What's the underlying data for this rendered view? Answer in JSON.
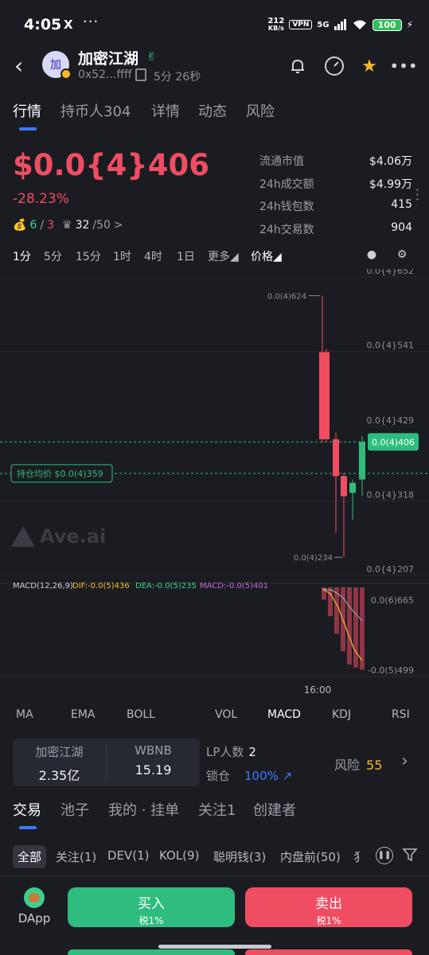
{
  "status_bar": {
    "time": "4:05",
    "app_icon": "X",
    "more": "···",
    "net_speed_top": "212",
    "net_speed_unit": "KB/s",
    "vpn": "VPN",
    "signal": "5G",
    "battery": "100"
  },
  "header": {
    "avatar_text": "加",
    "name": "加密江湖",
    "badge_icon": "✌",
    "address": "0x52...ffff",
    "age": "5分 26秒"
  },
  "main_tabs": [
    {
      "label": "行情",
      "active": true
    },
    {
      "label": "持币人304",
      "active": false
    },
    {
      "label": "详情",
      "active": false
    },
    {
      "label": "动态",
      "active": false
    },
    {
      "label": "风险",
      "active": false
    }
  ],
  "price": {
    "value": "$0.0{4}406",
    "change": "-28.23%",
    "chip1_a": "6",
    "chip1_sep": "/",
    "chip1_b": "3",
    "chip2_a": "32",
    "chip2_b": "/50",
    "chip2_chev": ">"
  },
  "stats": [
    {
      "k": "流通市值",
      "v": "$4.06万"
    },
    {
      "k": "24h成交额",
      "v": "$4.99万"
    },
    {
      "k": "24h钱包数",
      "v": "415"
    },
    {
      "k": "24h交易数",
      "v": "904"
    }
  ],
  "timeframes": [
    {
      "label": "1分",
      "active": true
    },
    {
      "label": "5分",
      "active": false
    },
    {
      "label": "15分",
      "active": false
    },
    {
      "label": "1时",
      "active": false
    },
    {
      "label": "4时",
      "active": false
    },
    {
      "label": "1日",
      "active": false
    },
    {
      "label": "更多◢",
      "active": false
    },
    {
      "label": "价格◢",
      "active": true
    }
  ],
  "chart_data": {
    "type": "candlestick",
    "y_ticks": [
      "0.0{4}652",
      "0.0{4}541",
      "0.0{4}429",
      "0.0{4}318",
      "0.0{4}207"
    ],
    "y_tick_values": [
      6.52e-05,
      5.41e-05,
      4.29e-05,
      3.18e-05,
      2.07e-05
    ],
    "ylim": [
      2.07e-05,
      6.52e-05
    ],
    "x_label": "16:00",
    "high_label": "0.0(4)624",
    "low_label": "0.0(4)234",
    "current_price_label": "0.0(4)406",
    "current_price": 4.06e-05,
    "avg_hold_label": "持仓均价 $0.0(4)359",
    "avg_hold_price": 3.59e-05,
    "watermark": "Ave.ai",
    "candles": [
      {
        "open": 4.1e-05,
        "close": 5.4e-05,
        "high": 6.24e-05,
        "low": 4.05e-05,
        "dir": "down"
      },
      {
        "open": 5.4e-05,
        "close": 4.1e-05,
        "high": 5.45e-05,
        "low": 4.05e-05,
        "dir": "down"
      },
      {
        "open": 4.1e-05,
        "close": 3.55e-05,
        "high": 4.2e-05,
        "low": 2.7e-05,
        "dir": "down"
      },
      {
        "open": 3.55e-05,
        "close": 3.25e-05,
        "high": 3.6e-05,
        "low": 2.34e-05,
        "dir": "down"
      },
      {
        "open": 3.3e-05,
        "close": 3.45e-05,
        "high": 3.5e-05,
        "low": 2.9e-05,
        "dir": "up"
      },
      {
        "open": 3.5e-05,
        "close": 4.06e-05,
        "high": 4.15e-05,
        "low": 3.25e-05,
        "dir": "up"
      }
    ],
    "macd": {
      "label": "MACD(12,26,9)",
      "dif": "DIF:-0.0(5)436",
      "dea": "DEA:-0.0(5)235",
      "macd": "MACD:-0.0(5)401",
      "y_ticks": [
        "0.0(6)665",
        "-0.0(5)499"
      ],
      "bars": [
        -1.2e-06,
        -2.8e-06,
        -4.5e-06,
        -6.2e-06,
        -7.5e-06,
        -7.8e-06,
        -8e-06
      ],
      "colors": {
        "dif": "#f3ba2f",
        "dea": "#3ecf8e",
        "macd": "#c06bd6"
      }
    }
  },
  "indicators": [
    {
      "label": "MA",
      "active": false
    },
    {
      "label": "EMA",
      "active": false
    },
    {
      "label": "BOLL",
      "active": false
    },
    {
      "label": "VOL",
      "active": false
    },
    {
      "label": "MACD",
      "active": true
    },
    {
      "label": "KDJ",
      "active": false
    },
    {
      "label": "RSI",
      "active": false
    }
  ],
  "pool": {
    "token_name": "加密江湖",
    "token_amount": "2.35亿",
    "pair_name": "WBNB",
    "pair_amount": "15.19",
    "lp_label": "LP人数",
    "lp_value": "2",
    "lock_label": "锁仓",
    "lock_value": "100%",
    "lock_icon": "↗",
    "risk_label": "风险",
    "risk_value": "55",
    "risk_chev": "›"
  },
  "trade_tabs": [
    {
      "label": "交易",
      "active": true
    },
    {
      "label": "池子",
      "active": false
    },
    {
      "label": "我的 · 挂单",
      "active": false
    },
    {
      "label": "关注1",
      "active": false
    },
    {
      "label": "创建者",
      "active": false
    }
  ],
  "filters": [
    {
      "label": "全部",
      "active": true
    },
    {
      "label": "关注(1)",
      "active": false
    },
    {
      "label": "DEV(1)",
      "active": false
    },
    {
      "label": "KOL(9)",
      "active": false
    },
    {
      "label": "聪明钱(3)",
      "active": false
    },
    {
      "label": "内盘前(50)",
      "active": false
    },
    {
      "label": "犭",
      "active": false
    }
  ],
  "bottom": {
    "dapp": "DApp",
    "buy": "买入",
    "buy_sub": "税1%",
    "sell": "卖出",
    "sell_sub": "税1%"
  },
  "colors": {
    "up": "#2ebd7e",
    "down": "#ef4d62",
    "accent": "#3d7bf7",
    "warn": "#f3ba2f",
    "bg": "#1b1c22"
  }
}
